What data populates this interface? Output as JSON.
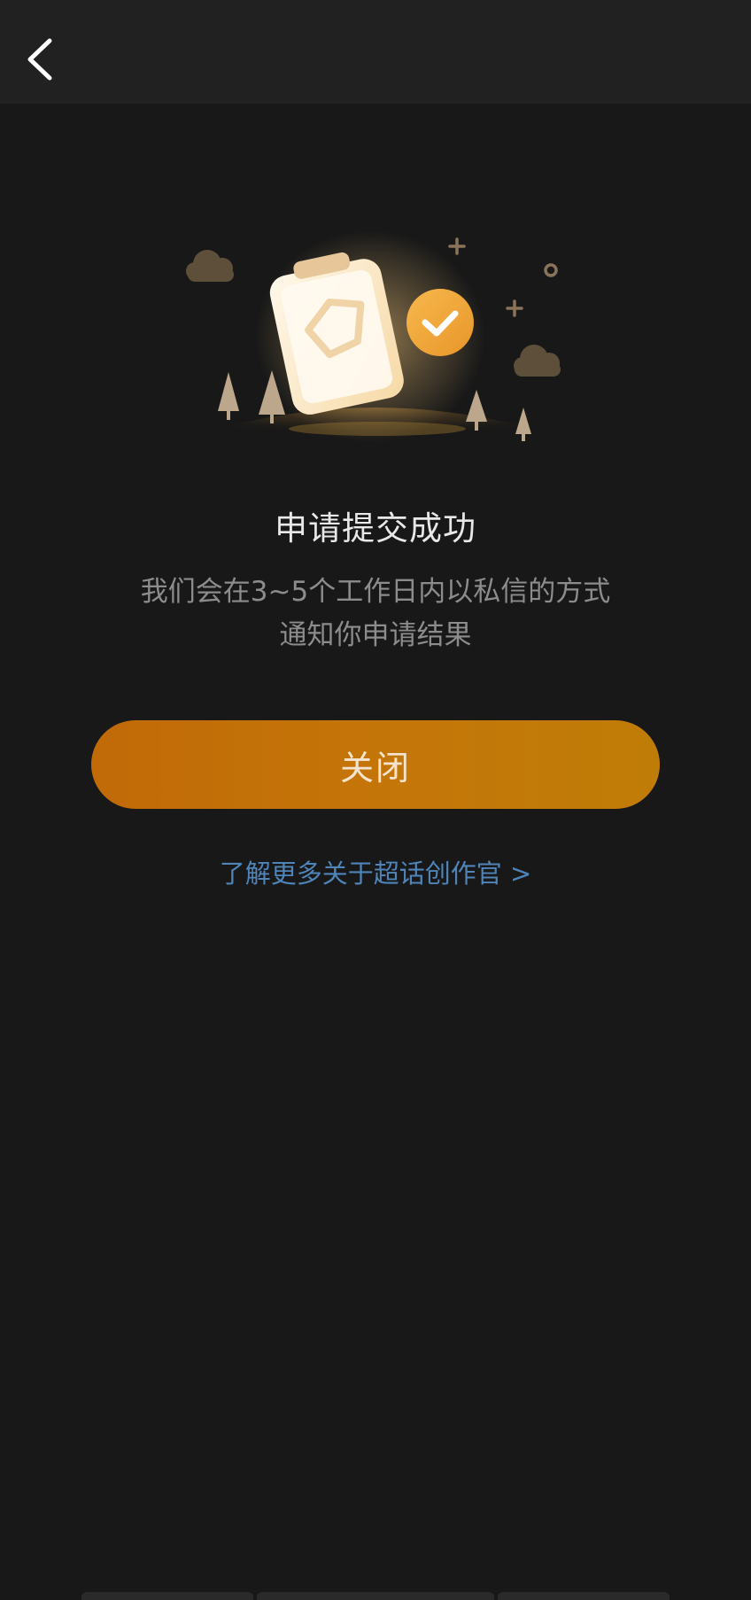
{
  "header": {
    "title": "",
    "back_icon": "chevron-left-icon"
  },
  "illustration": {
    "icon": "clipboard-success-illustration",
    "colors": {
      "accent": "#f2a93b",
      "tree": "#bda78e",
      "cloud": "#6a5a45",
      "card": "#fdf2df"
    }
  },
  "result": {
    "title": "申请提交成功",
    "message_lines": [
      "我们会在3~5个工作日内以私信的方式",
      "通知你申请结果"
    ]
  },
  "actions": {
    "close_label": "关闭",
    "learn_more_label": "了解更多关于超话创作官 >"
  },
  "colors": {
    "background": "#181818",
    "header": "#212121",
    "button_gradient": [
      "#c16a08",
      "#bf7d07"
    ],
    "link": "#4f84b8"
  }
}
